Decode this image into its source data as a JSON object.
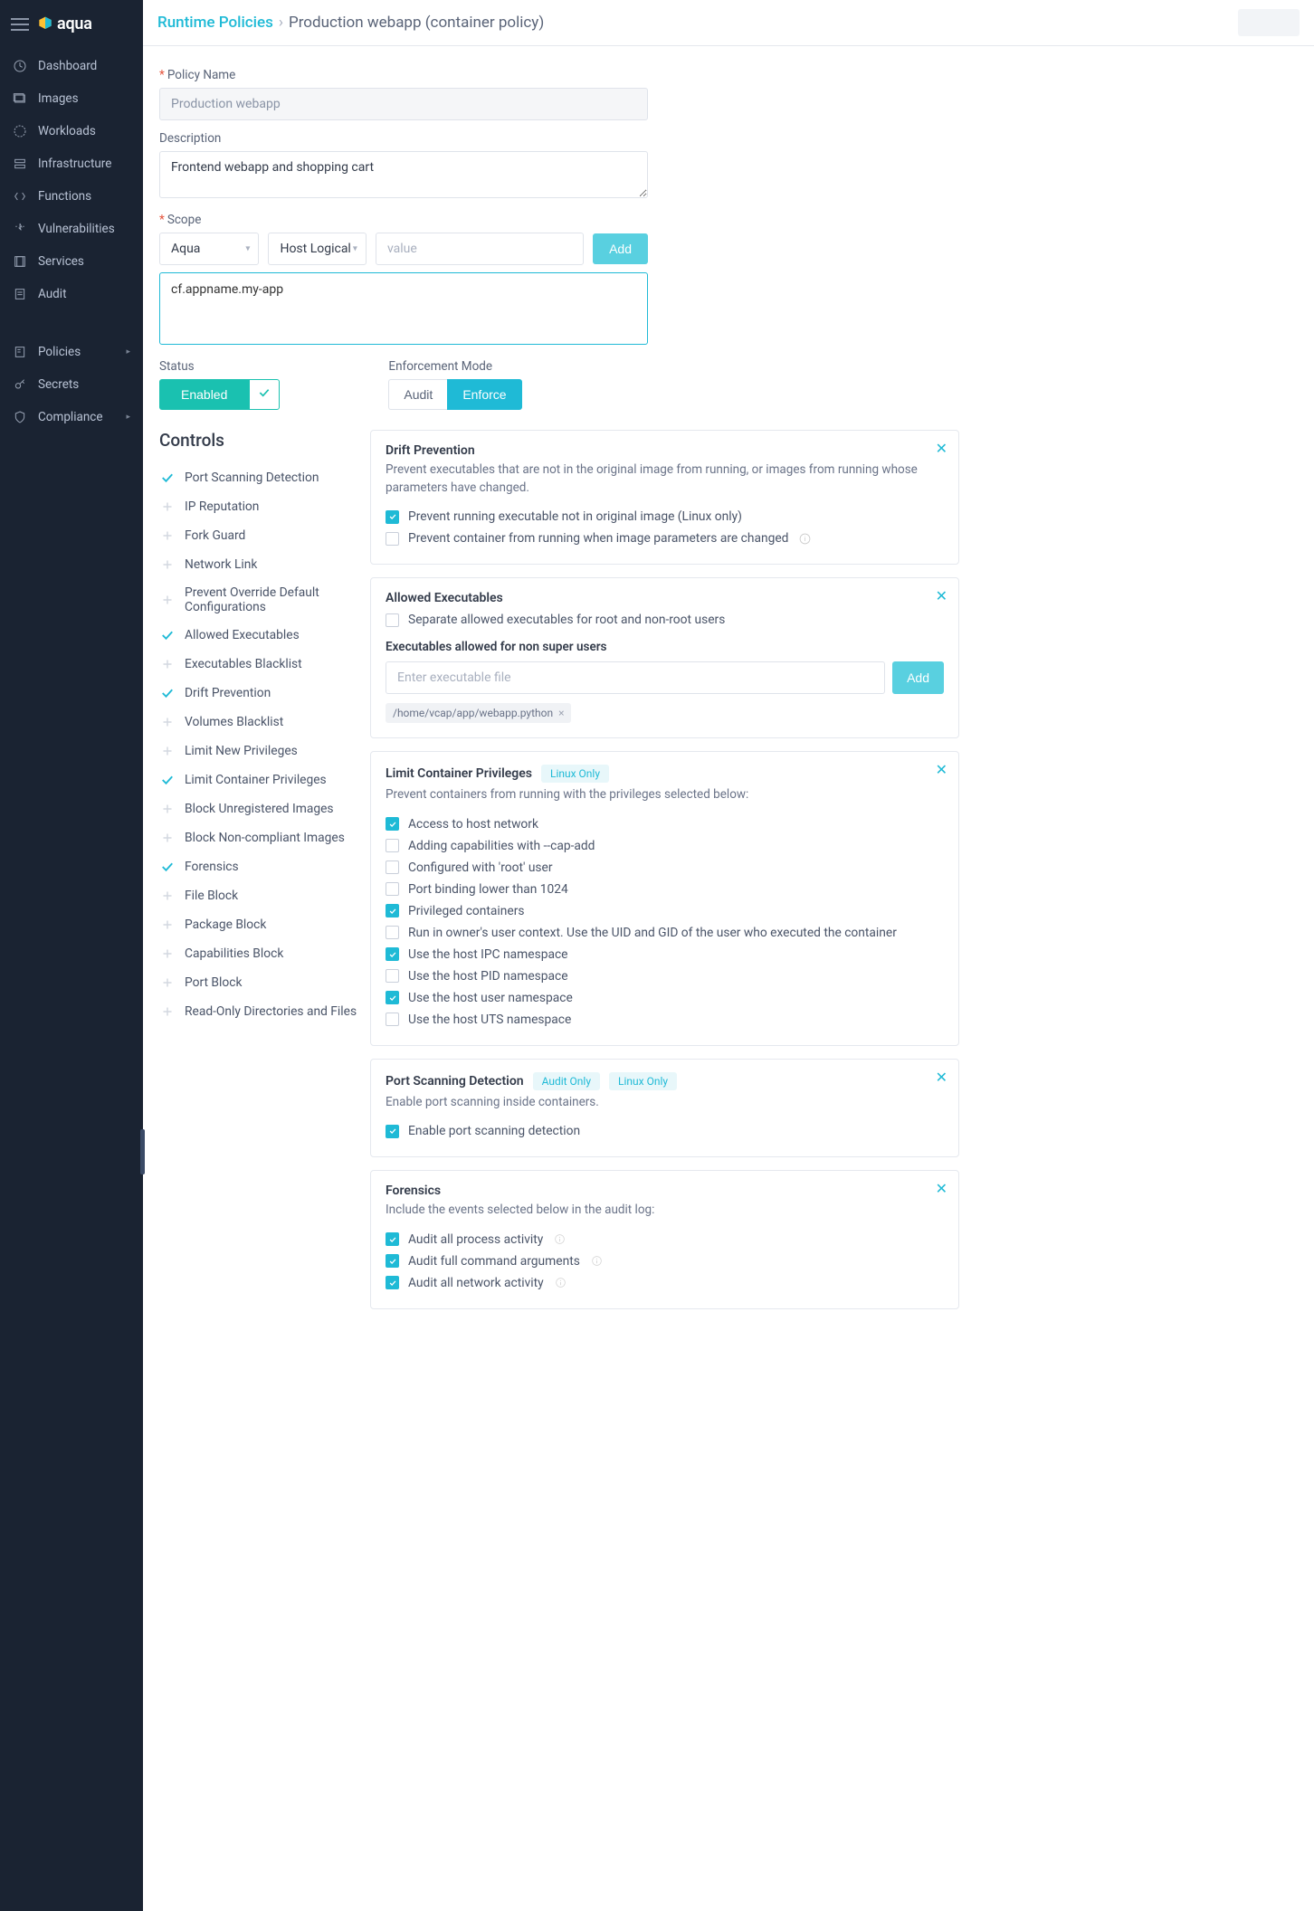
{
  "brand": "aqua",
  "nav": [
    {
      "label": "Dashboard"
    },
    {
      "label": "Images"
    },
    {
      "label": "Workloads"
    },
    {
      "label": "Infrastructure"
    },
    {
      "label": "Functions"
    },
    {
      "label": "Vulnerabilities"
    },
    {
      "label": "Services"
    },
    {
      "label": "Audit"
    }
  ],
  "nav2": [
    {
      "label": "Policies",
      "caret": true
    },
    {
      "label": "Secrets"
    },
    {
      "label": "Compliance",
      "caret": true
    }
  ],
  "breadcrumb": {
    "root": "Runtime Policies",
    "current": "Production webapp (container policy)"
  },
  "form": {
    "policy_name_label": "Policy Name",
    "policy_name_value": "Production webapp",
    "description_label": "Description",
    "description_value": "Frontend webapp and shopping cart",
    "scope_label": "Scope",
    "scope_select1": "Aqua",
    "scope_select2": "Host Logical N",
    "scope_value_ph": "value",
    "scope_add": "Add",
    "scope_tag": "cf.appname.my-app",
    "status_label": "Status",
    "status_enabled": "Enabled",
    "enforcement_label": "Enforcement Mode",
    "enforcement_audit": "Audit",
    "enforcement_enforce": "Enforce"
  },
  "controls_heading": "Controls",
  "controls": [
    {
      "label": "Port Scanning Detection",
      "on": true
    },
    {
      "label": "IP Reputation",
      "on": false
    },
    {
      "label": "Fork Guard",
      "on": false
    },
    {
      "label": "Network Link",
      "on": false
    },
    {
      "label": "Prevent Override Default Configurations",
      "on": false
    },
    {
      "label": "Allowed Executables",
      "on": true
    },
    {
      "label": "Executables Blacklist",
      "on": false
    },
    {
      "label": "Drift Prevention",
      "on": true
    },
    {
      "label": "Volumes Blacklist",
      "on": false
    },
    {
      "label": "Limit New Privileges",
      "on": false
    },
    {
      "label": "Limit Container Privileges",
      "on": true
    },
    {
      "label": "Block Unregistered Images",
      "on": false
    },
    {
      "label": "Block Non-compliant Images",
      "on": false
    },
    {
      "label": "Forensics",
      "on": true
    },
    {
      "label": "File Block",
      "on": false
    },
    {
      "label": "Package Block",
      "on": false
    },
    {
      "label": "Capabilities Block",
      "on": false
    },
    {
      "label": "Port Block",
      "on": false
    },
    {
      "label": "Read-Only Directories and Files",
      "on": false
    }
  ],
  "panels": {
    "drift": {
      "title": "Drift Prevention",
      "desc": "Prevent executables that are not in the original image from running, or images from running whose parameters have changed.",
      "opt1": "Prevent running executable not in original image (Linux only)",
      "opt2": "Prevent container from running when image parameters are changed"
    },
    "allowed": {
      "title": "Allowed Executables",
      "opt1": "Separate allowed executables for root and non-root users",
      "sub_label": "Executables allowed for non super users",
      "input_ph": "Enter executable file",
      "add": "Add",
      "tag": "/home/vcap/app/webapp.python"
    },
    "limit": {
      "title": "Limit Container Privileges",
      "badge": "Linux Only",
      "desc": "Prevent containers from running with the privileges selected below:",
      "opts": [
        {
          "label": "Access to host network",
          "on": true
        },
        {
          "label": "Adding capabilities with --cap-add",
          "on": false
        },
        {
          "label": "Configured with 'root' user",
          "on": false
        },
        {
          "label": "Port binding lower than 1024",
          "on": false
        },
        {
          "label": "Privileged containers",
          "on": true
        },
        {
          "label": "Run in owner's user context. Use the UID and GID of the user who executed the container",
          "on": false
        },
        {
          "label": "Use the host IPC namespace",
          "on": true
        },
        {
          "label": "Use the host PID namespace",
          "on": false
        },
        {
          "label": "Use the host user namespace",
          "on": true
        },
        {
          "label": "Use the host UTS namespace",
          "on": false
        }
      ]
    },
    "portscan": {
      "title": "Port Scanning Detection",
      "badge1": "Audit Only",
      "badge2": "Linux Only",
      "desc": "Enable port scanning inside containers.",
      "opt1": "Enable port scanning detection"
    },
    "forensics": {
      "title": "Forensics",
      "desc": "Include the events selected below in the audit log:",
      "opts": [
        {
          "label": "Audit all process activity",
          "on": true,
          "info": true
        },
        {
          "label": "Audit full command arguments",
          "on": true,
          "info": true
        },
        {
          "label": "Audit all network activity",
          "on": true,
          "info": true
        }
      ]
    }
  }
}
